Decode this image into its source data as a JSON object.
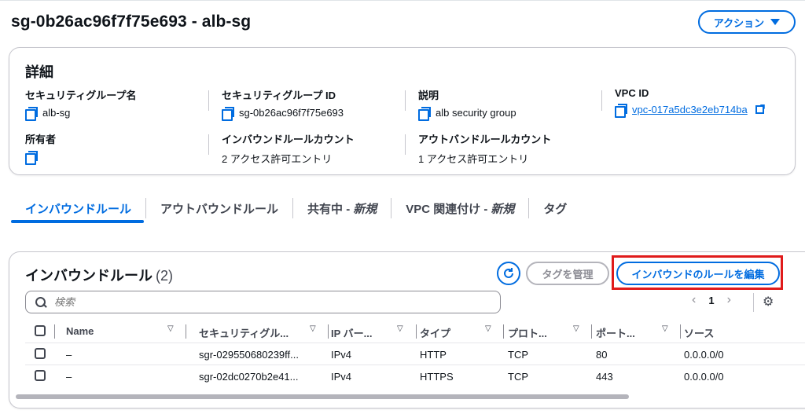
{
  "header": {
    "title": "sg-0b26ac96f7f75e693 - alb-sg",
    "action_label": "アクション"
  },
  "details": {
    "title": "詳細",
    "fields": {
      "sg_name": {
        "label": "セキュリティグループ名",
        "value": "alb-sg"
      },
      "sg_id": {
        "label": "セキュリティグループ ID",
        "value": "sg-0b26ac96f7f75e693"
      },
      "description": {
        "label": "説明",
        "value": "alb security group"
      },
      "vpc_id": {
        "label": "VPC ID",
        "value": "vpc-017a5dc3e2eb714ba"
      },
      "owner": {
        "label": "所有者",
        "value": ""
      },
      "inbound_count": {
        "label": "インバウンドルールカウント",
        "value": "2 アクセス許可エントリ"
      },
      "outbound_count": {
        "label": "アウトバンドルールカウント",
        "value": "1 アクセス許可エントリ"
      }
    }
  },
  "tabs": [
    {
      "label": "インバウンドルール",
      "suffix": ""
    },
    {
      "label": "アウトバウンドルール",
      "suffix": ""
    },
    {
      "label": "共有中 -",
      "suffix": "新規"
    },
    {
      "label": "VPC 関連付け -",
      "suffix": "新規"
    },
    {
      "label": "タグ",
      "suffix": ""
    }
  ],
  "rules": {
    "title": "インバウンドルール",
    "count": "(2)",
    "manage_tags_label": "タグを管理",
    "edit_label": "インバウンドのルールを編集",
    "search_placeholder": "検索",
    "page_number": "1",
    "columns": [
      "Name",
      "セキュリティグル...",
      "IP バー...",
      "タイプ",
      "プロト...",
      "ポート...",
      "ソース"
    ],
    "rows": [
      {
        "name": "–",
        "sgr": "sgr-029550680239ff...",
        "ip": "IPv4",
        "type": "HTTP",
        "proto": "TCP",
        "port": "80",
        "source": "0.0.0.0/0"
      },
      {
        "name": "–",
        "sgr": "sgr-02dc0270b2e41...",
        "ip": "IPv4",
        "type": "HTTPS",
        "proto": "TCP",
        "port": "443",
        "source": "0.0.0.0/0"
      }
    ]
  },
  "colors": {
    "accent": "#006ce0",
    "highlight": "#e01b1b"
  }
}
